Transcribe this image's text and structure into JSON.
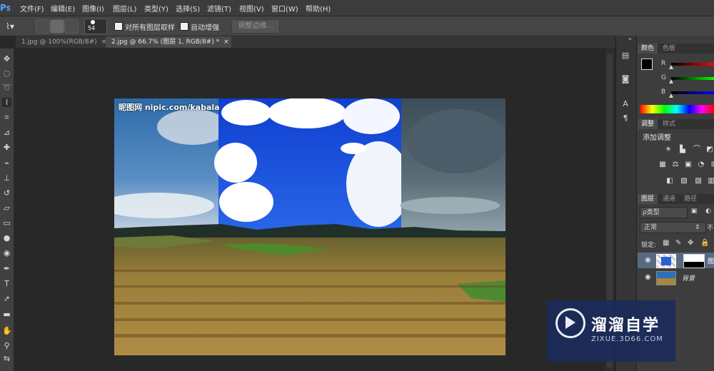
{
  "app": {
    "logo": "Ps"
  },
  "menu": [
    "文件(F)",
    "编辑(E)",
    "图像(I)",
    "图层(L)",
    "类型(Y)",
    "选择(S)",
    "滤镜(T)",
    "视图(V)",
    "窗口(W)",
    "帮助(H)"
  ],
  "options": {
    "brush_size": "54",
    "sample_all_layers": "对所有图层取样",
    "auto_enhance": "自动增强",
    "refine_edge": "调整边缘..."
  },
  "tabs": [
    {
      "label": "1.jpg @ 100%(RGB/8#)",
      "close": "×",
      "active": false
    },
    {
      "label": "2.jpg @ 66.7% (图层 1, RGB/8#) *",
      "close": "×",
      "active": true
    }
  ],
  "document": {
    "watermark_text": "昵图网 nipic.com/kabala"
  },
  "panels": {
    "color": {
      "tab_active": "颜色",
      "tab_inactive": "色板",
      "channels": [
        "R",
        "G",
        "B"
      ]
    },
    "adjustments": {
      "tab_active": "调整",
      "tab_inactive": "样式",
      "title": "添加调整"
    },
    "layers": {
      "tabs": [
        "图层",
        "通道",
        "路径"
      ],
      "filter_label": "ρ类型",
      "blend_mode": "正常",
      "opacity_prefix": "不",
      "lock_label": "锁定:",
      "layer1_name": "图",
      "background_name": "背景"
    }
  },
  "watermark": {
    "title": "溜溜自学",
    "subtitle": "ZIXUE.3D66.COM"
  },
  "colors": {
    "accent": "#4fa6ff",
    "watermark_bg": "#1c2b5a"
  }
}
